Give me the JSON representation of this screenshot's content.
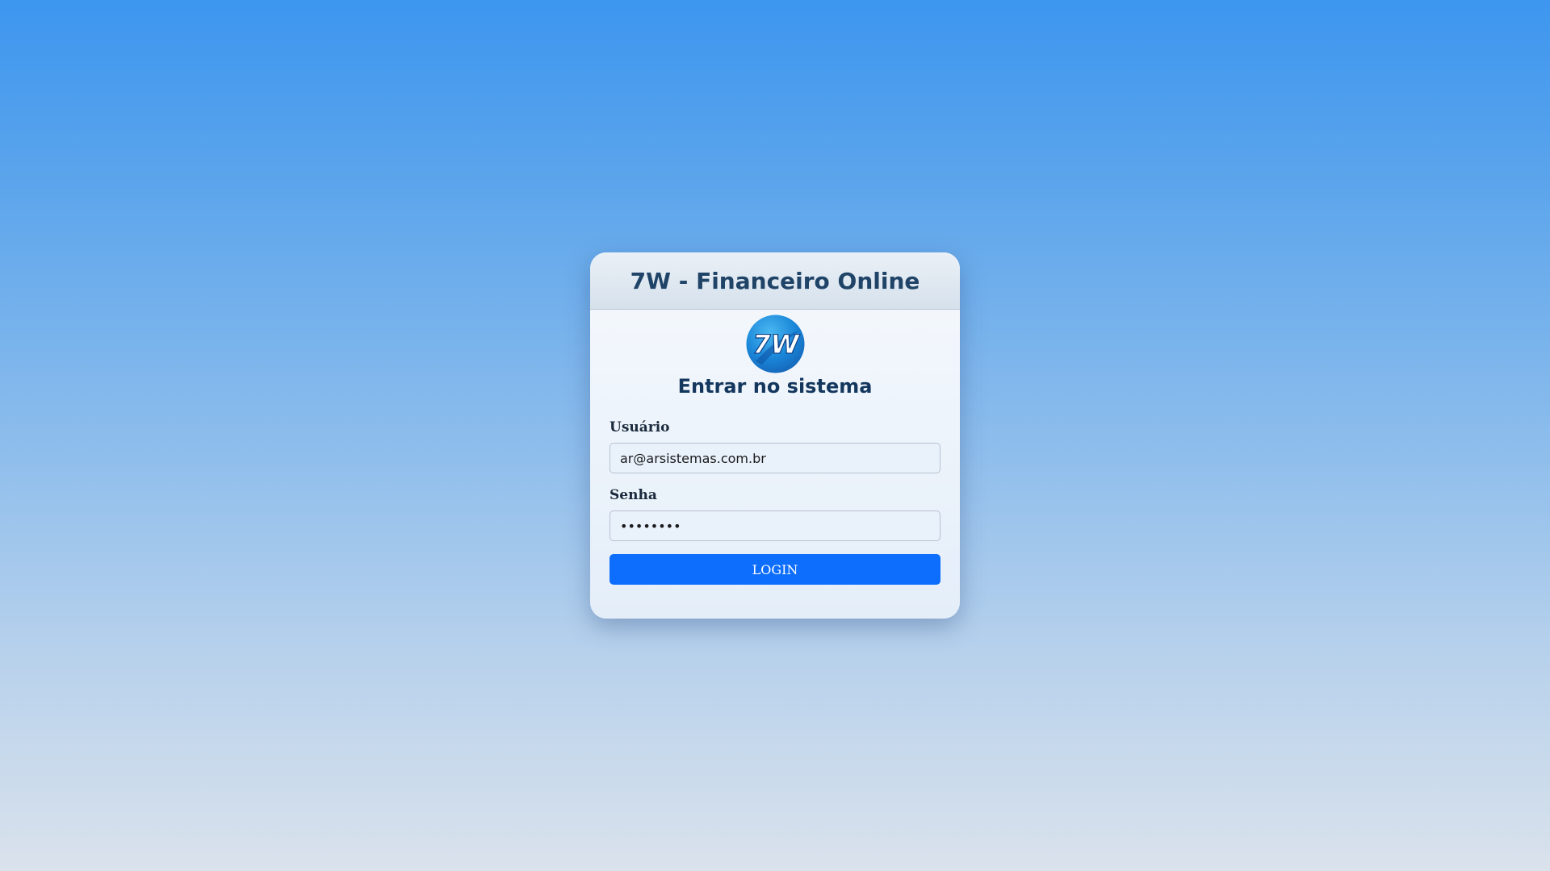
{
  "header": {
    "title": "7W - Financeiro Online"
  },
  "logo": {
    "text": "7W",
    "icon": "7w-logo-icon"
  },
  "form": {
    "heading": "Entrar no sistema",
    "username_label": "Usuário",
    "username_value": "ar@arsistemas.com.br",
    "password_label": "Senha",
    "password_value": "••••••••",
    "login_label": "LOGIN"
  },
  "colors": {
    "primary_button": "#0d6efd",
    "title_text": "#1f4468",
    "heading_text": "#14375e"
  }
}
